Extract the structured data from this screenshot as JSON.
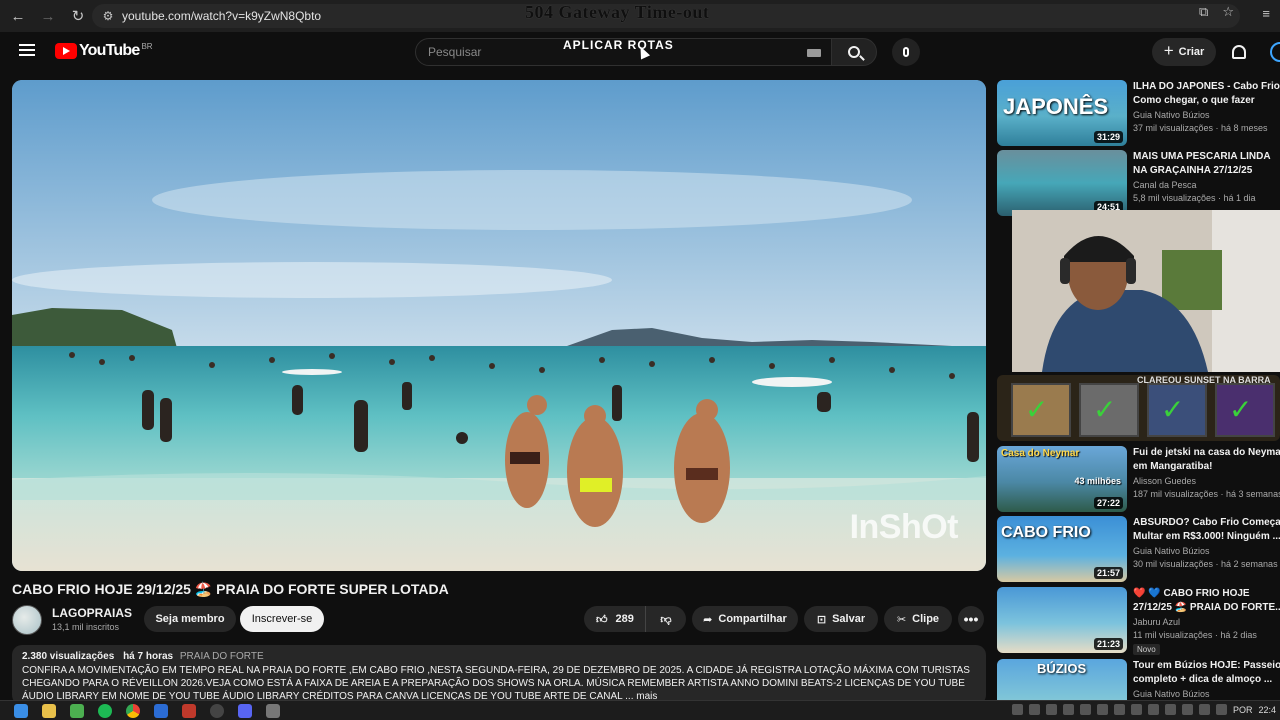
{
  "browser": {
    "url": "youtube.com/watch?v=k9yZwN8Qbto",
    "overlay_error": "504 Gateway Time-out"
  },
  "header": {
    "logo_text": "YouTube",
    "country_code": "BR",
    "search_placeholder": "Pesquisar",
    "overlay_text": "APLICAR ROTAS",
    "create_label": "Criar"
  },
  "video": {
    "watermark": "InShOt",
    "title": "CABO FRIO HOJE 29/12/25 🏖️ PRAIA DO FORTE SUPER LOTADA",
    "channel_name": "LAGOPRAIAS",
    "subscribers": "13,1 mil inscritos",
    "member_label": "Seja membro",
    "subscribe_label": "Inscrever-se",
    "likes": "289",
    "share_label": "Compartilhar",
    "save_label": "Salvar",
    "clip_label": "Clipe",
    "views": "2.380 visualizações",
    "age": "há 7 horas",
    "tag": "PRAIA DO FORTE",
    "description": "CONFIRA A MOVIMENTAÇÃO EM TEMPO REAL NA PRAIA DO FORTE ,EM CABO FRIO ,NESTA SEGUNDA-FEIRA, 29 DE DEZEMBRO DE 2025. A CIDADE JÁ REGISTRA LOTAÇÃO MÁXIMA COM TURISTAS CHEGANDO PARA O RÉVEILLON 2026.VEJA COMO ESTÁ A FAIXA DE AREIA E A PREPARAÇÃO DOS SHOWS NA ORLA. MÚSICA REMEMBER ARTISTA ANNO DOMINI BEATS-2 LICENÇAS DE YOU TUBE ÁUDIO LIBRARY EM NOME DE YOU TUBE ÁUDIO LIBRARY CRÉDITOS PARA CANVA LICENÇAS DE YOU TUBE ARTE DE CANAL ... mais"
  },
  "recommendations": [
    {
      "title_line1": "ILHA DO JAPONES - Cabo Frio",
      "title_line2": "Como chegar, o que fazer",
      "channel": "Guia Nativo Búzios",
      "stats": "37 mil visualizações · há 8 meses",
      "duration": "31:29",
      "thumb_text": "JAPONÊS"
    },
    {
      "title_line1": "MAIS UMA PESCARIA LINDA",
      "title_line2": "NA GRAÇAINHA 27/12/25",
      "channel": "Canal da Pesca",
      "stats": "5,8 mil visualizações · há 1 dia",
      "duration": "24:51"
    },
    {
      "title_line1": "Fui de jetski na casa do Neymar",
      "title_line2": "em Mangaratiba!",
      "channel": "Alisson Guedes",
      "stats": "187 mil visualizações · há 3 semanas",
      "duration": "27:22",
      "thumb_text": "Casa do Neymar",
      "thumb_sub": "43 milhões"
    },
    {
      "title_line1": "ABSURDO? Cabo Frio Começa",
      "title_line2": "Multar em R$3.000! Ninguém ...",
      "channel": "Guia Nativo Búzios",
      "stats": "30 mil visualizações · há 2 semanas",
      "duration": "21:57",
      "thumb_text": "CABO FRIO"
    },
    {
      "title_line1": "❤️ 💙 CABO FRIO HOJE",
      "title_line2": "27/12/25 🏖️ PRAIA DO FORTE...",
      "channel": "Jaburu Azul",
      "stats": "11 mil visualizações · há 2 dias",
      "duration": "21:23",
      "badge": "Novo"
    },
    {
      "title_line1": "Tour em Búzios HOJE: Passeio",
      "title_line2": "completo + dica de almoço ...",
      "channel": "Guia Nativo Búzios",
      "stats": "",
      "duration": "",
      "thumb_text": "BÚZIOS"
    }
  ],
  "apps_strip_text": "CLAREOU SUNSET NA BARRA",
  "taskbar": {
    "language": "POR",
    "time": "22:4"
  },
  "colors": {
    "background": "#0f0f0f",
    "accent_red": "#ff0000",
    "button_dark": "#272727",
    "text_secondary": "#aaaaaa"
  }
}
